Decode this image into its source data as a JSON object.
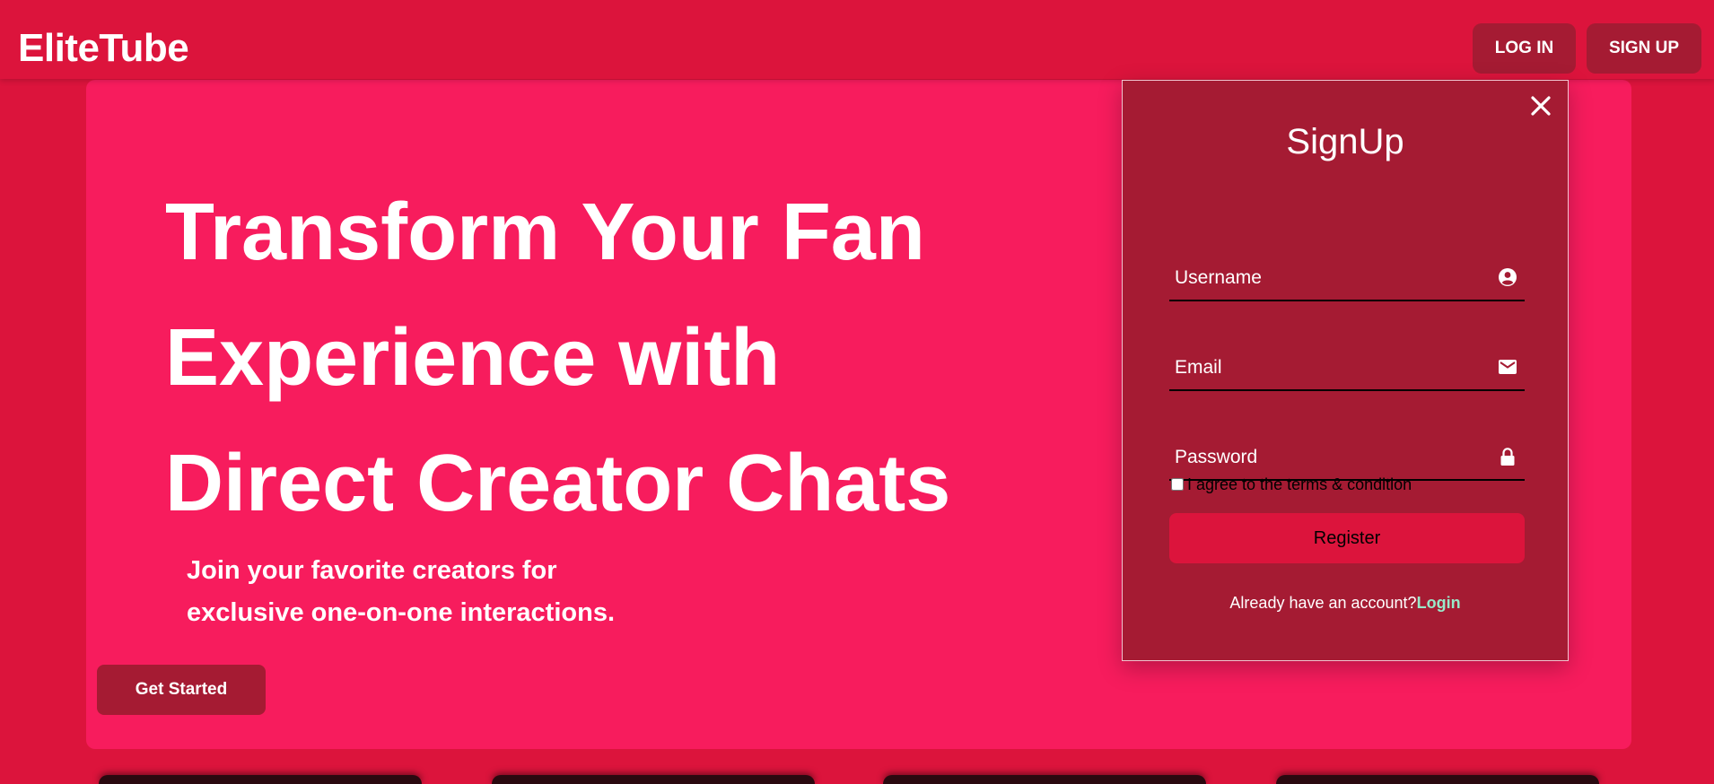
{
  "navbar": {
    "brand": "EliteTube",
    "login_label": "LOG IN",
    "signup_label": "SIGN UP"
  },
  "hero": {
    "title_lines": [
      "Transform Your Fan",
      "Experience with",
      "Direct Creator Chats"
    ],
    "subtitle_lines": [
      "Join your favorite creators for",
      "exclusive one-on-one interactions."
    ],
    "cta_label": "Get Started"
  },
  "signup_modal": {
    "title": "SignUp",
    "username_placeholder": "Username",
    "email_placeholder": "Email",
    "password_placeholder": "Password",
    "terms_label": "I agree to the terms & condition",
    "register_label": "Register",
    "already_text": "Already have an account?",
    "login_link": "Login",
    "icons": [
      "close-icon",
      "user-circle-icon",
      "envelope-icon",
      "lock-icon"
    ]
  },
  "colors": {
    "page_bg": "#dc143c",
    "hero_bg": "#f71c5d",
    "dark_accent": "#a51b33",
    "link": "#98e9c9"
  }
}
